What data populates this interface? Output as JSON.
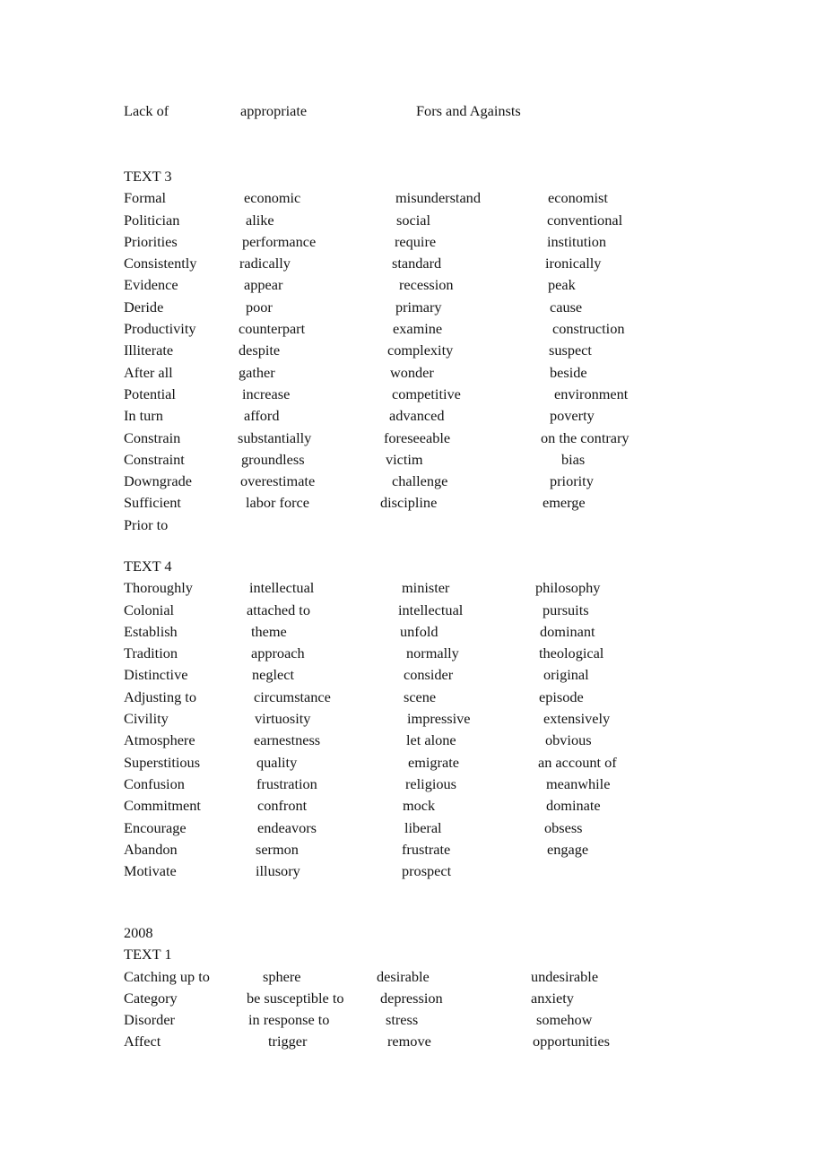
{
  "document": {
    "page_background": "#ffffff",
    "text_color": "#141414"
  },
  "header_row": {
    "col1": "Lack of",
    "col2": "appropriate",
    "col3": "Fors and Againsts",
    "col4": ""
  },
  "sections": [
    {
      "id": "text3",
      "heading": "TEXT 3",
      "rows": [
        {
          "col1": "Formal",
          "col2": "economic",
          "col3": "misunderstand",
          "col4": "economist"
        },
        {
          "col1": "Politician",
          "col2": "alike",
          "col3": "social",
          "col4": "conventional"
        },
        {
          "col1": "Priorities",
          "col2": "performance",
          "col3": "require",
          "col4": "institution"
        },
        {
          "col1": "Consistently",
          "col2": "radically",
          "col3": "standard",
          "col4": "ironically"
        },
        {
          "col1": "Evidence",
          "col2": "appear",
          "col3": "recession",
          "col4": "peak"
        },
        {
          "col1": "Deride",
          "col2": "poor",
          "col3": "primary",
          "col4": "cause"
        },
        {
          "col1": "Productivity",
          "col2": "counterpart",
          "col3": "examine",
          "col4": "construction"
        },
        {
          "col1": "Illiterate",
          "col2": "despite",
          "col3": "complexity",
          "col4": "suspect"
        },
        {
          "col1": "After all",
          "col2": "gather",
          "col3": "wonder",
          "col4": "beside"
        },
        {
          "col1": "Potential",
          "col2": "increase",
          "col3": "competitive",
          "col4": "environment"
        },
        {
          "col1": "In turn",
          "col2": "afford",
          "col3": "advanced",
          "col4": "poverty"
        },
        {
          "col1": "Constrain",
          "col2": "substantially",
          "col3": "foreseeable",
          "col4": "on the contrary"
        },
        {
          "col1": "Constraint",
          "col2": "groundless",
          "col3": "victim",
          "col4": "bias"
        },
        {
          "col1": "Downgrade",
          "col2": "overestimate",
          "col3": "challenge",
          "col4": "priority"
        },
        {
          "col1": "Sufficient",
          "col2": "labor force",
          "col3": "discipline",
          "col4": "emerge"
        },
        {
          "col1": "Prior to",
          "col2": "",
          "col3": "",
          "col4": ""
        }
      ]
    },
    {
      "id": "text4",
      "heading": "TEXT 4",
      "rows": [
        {
          "col1": "Thoroughly",
          "col2": "intellectual",
          "col3": "minister",
          "col4": "philosophy"
        },
        {
          "col1": "Colonial",
          "col2": "attached to",
          "col3": "intellectual",
          "col4": "pursuits"
        },
        {
          "col1": "Establish",
          "col2": "theme",
          "col3": "unfold",
          "col4": "dominant"
        },
        {
          "col1": "Tradition",
          "col2": "approach",
          "col3": "normally",
          "col4": "theological"
        },
        {
          "col1": "Distinctive",
          "col2": "neglect",
          "col3": "consider",
          "col4": "original"
        },
        {
          "col1": "Adjusting to",
          "col2": "circumstance",
          "col3": "scene",
          "col4": "episode"
        },
        {
          "col1": "Civility",
          "col2": "virtuosity",
          "col3": "impressive",
          "col4": "extensively"
        },
        {
          "col1": "Atmosphere",
          "col2": "earnestness",
          "col3": "let alone",
          "col4": "obvious"
        },
        {
          "col1": "Superstitious",
          "col2": "quality",
          "col3": "emigrate",
          "col4": "an account of"
        },
        {
          "col1": "Confusion",
          "col2": "frustration",
          "col3": "religious",
          "col4": "meanwhile"
        },
        {
          "col1": "Commitment",
          "col2": "confront",
          "col3": "mock",
          "col4": "dominate"
        },
        {
          "col1": "Encourage",
          "col2": "endeavors",
          "col3": "liberal",
          "col4": "obsess"
        },
        {
          "col1": "Abandon",
          "col2": "sermon",
          "col3": "frustrate",
          "col4": "engage"
        },
        {
          "col1": "Motivate",
          "col2": "illusory",
          "col3": "prospect",
          "col4": ""
        }
      ]
    },
    {
      "id": "block2008",
      "year": "2008",
      "heading": "TEXT 1",
      "rows": [
        {
          "col1": "Catching up to",
          "col2": "sphere",
          "col3": "desirable",
          "col4": "undesirable"
        },
        {
          "col1": "Category",
          "col2": "be susceptible to",
          "col3": "depression",
          "col4": "anxiety"
        },
        {
          "col1": "Disorder",
          "col2": "in response to",
          "col3": "stress",
          "col4": "somehow"
        },
        {
          "col1": "Affect",
          "col2": "trigger",
          "col3": "remove",
          "col4": "opportunities"
        }
      ]
    }
  ]
}
